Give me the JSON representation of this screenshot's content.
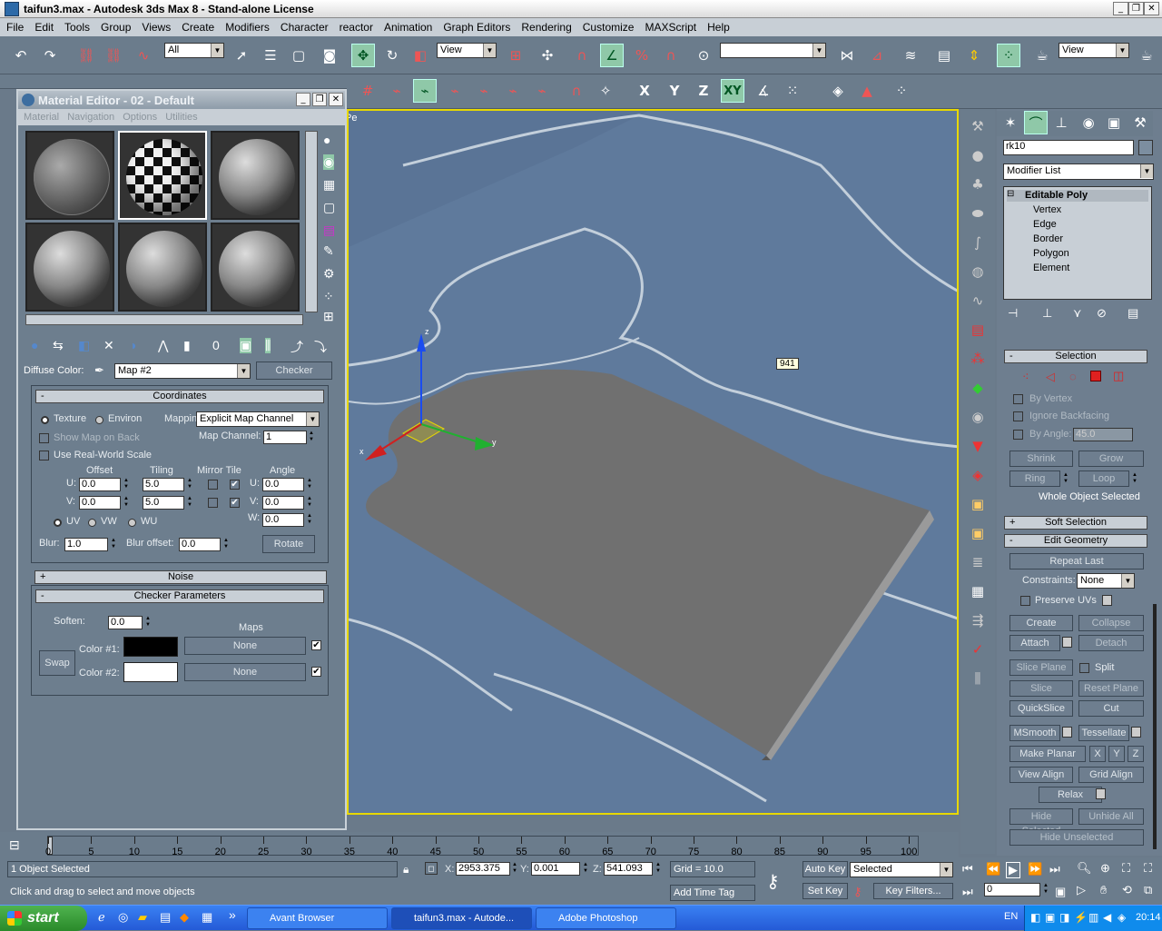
{
  "window": {
    "title": "taifun3.max - Autodesk 3ds Max 8  - Stand-alone License"
  },
  "menu": [
    "File",
    "Edit",
    "Tools",
    "Group",
    "Views",
    "Create",
    "Modifiers",
    "Character",
    "reactor",
    "Animation",
    "Graph Editors",
    "Rendering",
    "Customize",
    "MAXScript",
    "Help"
  ],
  "toolbar": {
    "selection_filter": "All",
    "ref_coord": "View",
    "ref_coord2": "View"
  },
  "axis_buttons": [
    "X",
    "Y",
    "Z",
    "XY"
  ],
  "material_editor": {
    "title": "Material Editor - 02 - Default",
    "menu": [
      "Material",
      "Navigation",
      "Options",
      "Utilities"
    ],
    "diffuse_label": "Diffuse Color:",
    "map_name": "Map #2",
    "map_type": "Checker",
    "coordinates": {
      "header": "Coordinates",
      "texture": "Texture",
      "environ": "Environ",
      "mapping_label": "Mapping:",
      "mapping_value": "Explicit Map Channel",
      "show_map_on_back": "Show Map on Back",
      "map_channel_label": "Map Channel:",
      "map_channel": "1",
      "use_real_world": "Use Real-World Scale",
      "offset": "Offset",
      "tiling": "Tiling",
      "mirror_tile": "Mirror Tile",
      "angle": "Angle",
      "u_label": "U:",
      "v_label": "V:",
      "w_label": "W:",
      "u_offset": "0.0",
      "v_offset": "0.0",
      "u_tiling": "5.0",
      "v_tiling": "5.0",
      "u_angle": "0.0",
      "v_angle": "0.0",
      "w_angle": "0.0",
      "uv": "UV",
      "vw": "VW",
      "wu": "WU",
      "blur_label": "Blur:",
      "blur": "1.0",
      "blur_offset_label": "Blur offset:",
      "blur_offset": "0.0",
      "rotate": "Rotate"
    },
    "noise_header": "Noise",
    "checker": {
      "header": "Checker Parameters",
      "soften_label": "Soften:",
      "soften": "0.0",
      "maps": "Maps",
      "swap": "Swap",
      "color1_label": "Color #1:",
      "color2_label": "Color #2:",
      "color1": "#000000",
      "color2": "#ffffff",
      "map1": "None",
      "map2": "None"
    }
  },
  "viewport": {
    "label": "Pe",
    "tooltip": "941",
    "axis": {
      "x": "x",
      "y": "y",
      "z": "z"
    }
  },
  "command_panel": {
    "object_name": "rk10",
    "modifier_list": "Modifier List",
    "stack": {
      "top": "Editable Poly",
      "items": [
        "Vertex",
        "Edge",
        "Border",
        "Polygon",
        "Element"
      ]
    },
    "selection": {
      "header": "Selection",
      "by_vertex": "By Vertex",
      "ignore_backfacing": "Ignore Backfacing",
      "by_angle": "By Angle:",
      "angle": "45.0",
      "shrink": "Shrink",
      "grow": "Grow",
      "ring": "Ring",
      "loop": "Loop",
      "status": "Whole Object Selected"
    },
    "soft_selection": "Soft Selection",
    "edit_geometry": {
      "header": "Edit Geometry",
      "repeat_last": "Repeat Last",
      "constraints_label": "Constraints:",
      "constraints": "None",
      "preserve_uvs": "Preserve UVs",
      "create": "Create",
      "collapse": "Collapse",
      "attach": "Attach",
      "detach": "Detach",
      "slice_plane": "Slice Plane",
      "split": "Split",
      "slice": "Slice",
      "reset_plane": "Reset Plane",
      "quickslice": "QuickSlice",
      "cut": "Cut",
      "msmooth": "MSmooth",
      "tessellate": "Tessellate",
      "make_planar": "Make Planar",
      "x": "X",
      "y": "Y",
      "z": "Z",
      "view_align": "View Align",
      "grid_align": "Grid Align",
      "relax": "Relax",
      "hide_selected": "Hide Selected",
      "unhide_all": "Unhide All",
      "hide_unselected": "Hide Unselected"
    }
  },
  "timeline": {
    "ticks": [
      "0",
      "5",
      "10",
      "15",
      "20",
      "25",
      "30",
      "35",
      "40",
      "45",
      "50",
      "55",
      "60",
      "65",
      "70",
      "75",
      "80",
      "85",
      "90",
      "95",
      "100"
    ],
    "slider": "0 / 100"
  },
  "status": {
    "selected": "1 Object Selected",
    "prompt": "Click and drag to select and move objects",
    "x_label": "X:",
    "x": "2953.375",
    "y_label": "Y:",
    "y": "0.001",
    "z_label": "Z:",
    "z": "541.093",
    "grid": "Grid = 10.0",
    "add_time_tag": "Add Time Tag",
    "auto_key": "Auto Key",
    "selected_dd": "Selected",
    "set_key": "Set Key",
    "key_filters": "Key Filters...",
    "frame": "0"
  },
  "taskbar": {
    "start": "start",
    "tasks": [
      "Avant Browser",
      "taifun3.max - Autode...",
      "Adobe Photoshop"
    ],
    "lang": "EN",
    "clock": "20:14"
  }
}
